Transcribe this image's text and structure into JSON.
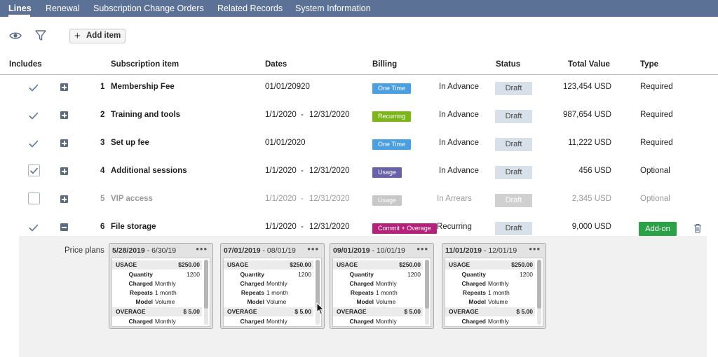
{
  "tabs": [
    {
      "label": "Lines",
      "active": true
    },
    {
      "label": "Renewal"
    },
    {
      "label": "Subscription Change Orders"
    },
    {
      "label": "Related Records"
    },
    {
      "label": "System Information"
    }
  ],
  "toolbar": {
    "visibility_icon": "eye-icon",
    "filter_icon": "filter-icon",
    "add_item_label": "Add item"
  },
  "columns": {
    "includes": "Includes",
    "subscription_item": "Subscription item",
    "dates": "Dates",
    "billing": "Billing",
    "status": "Status",
    "total_value": "Total Value",
    "type": "Type"
  },
  "lines": [
    {
      "include": "check",
      "expander": "plus",
      "num": "1",
      "name": "Membership Fee",
      "date_start": "01/01/20920",
      "date_end": "",
      "billing": "One Time",
      "billing_color": "#4a9fe0",
      "timing": "In Advance",
      "status": "Draft",
      "total": "123,454 USD",
      "type": "Required"
    },
    {
      "include": "check",
      "expander": "plus",
      "num": "2",
      "name": "Training and tools",
      "date_start": "1/1/2020",
      "date_end": "12/31/2020",
      "billing": "Recurring",
      "billing_color": "#7cb518",
      "timing": "In Advance",
      "status": "Draft",
      "total": "987,654 USD",
      "type": "Required"
    },
    {
      "include": "check",
      "expander": "plus",
      "num": "3",
      "name": "Set up fee",
      "date_start": "01/01/2020",
      "date_end": "",
      "billing": "One Time",
      "billing_color": "#4a9fe0",
      "timing": "In Advance",
      "status": "Draft",
      "total": "11,222 USD",
      "type": "Required"
    },
    {
      "include": "checkbox-checked",
      "expander": "plus",
      "num": "4",
      "name": "Additional sessions",
      "date_start": "1/1/2020",
      "date_end": "12/31/2020",
      "billing": "Usage",
      "billing_color": "#6860a8",
      "timing": "In Advance",
      "status": "Draft",
      "total": "456 USD",
      "type": "Optional"
    },
    {
      "include": "checkbox-empty",
      "expander": "plus",
      "num": "5",
      "name": "VIP access",
      "date_start": "1/1/2020",
      "date_end": "12/31/2020",
      "billing": "Usage",
      "billing_color": "#c8c8c8",
      "timing": "In Arrears",
      "status": "Draft",
      "total": "2,345 USD",
      "type": "Optional",
      "muted": true
    },
    {
      "include": "check",
      "expander": "minus",
      "num": "6",
      "name": "File storage",
      "date_start": "1/1/2020",
      "date_end": "12/31/2020",
      "billing": "Commit + Overage",
      "billing_color": "#b5217a",
      "timing": "Recurring",
      "status": "Draft",
      "total": "9,000 USD",
      "type": "Add-on",
      "type_badge": true,
      "delete_icon": "trash-icon"
    }
  ],
  "price_plans": {
    "label": "Price plans",
    "plans": [
      {
        "start": "5/28/2019",
        "end": "6/30/19"
      },
      {
        "start": "07/01/2019",
        "end": "08/01/19"
      },
      {
        "start": "09/01/2019",
        "end": "10/01/19"
      },
      {
        "start": "11/01/2019",
        "end": "12/01/19"
      }
    ],
    "usage_label": "USAGE",
    "usage_price": "$250.00",
    "quantity_label": "Quantity",
    "quantity": "1200",
    "charged_label": "Charged",
    "charged": "Monthly",
    "repeats_label": "Repeats",
    "repeats": "1 month",
    "model_label": "Model",
    "model": "Volume",
    "overage_label": "OVERAGE",
    "overage_price": "$ 5.00",
    "overage_charged": "Monthly",
    "dots": "•••"
  }
}
